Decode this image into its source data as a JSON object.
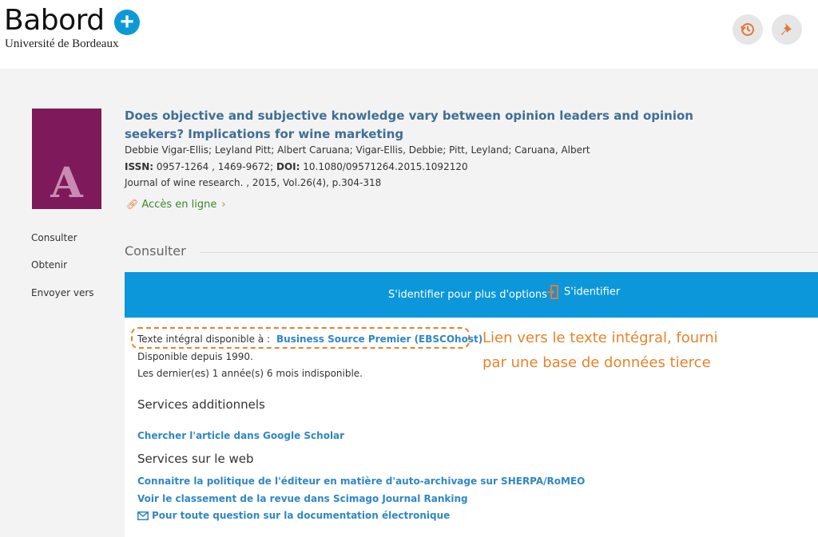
{
  "header": {
    "logo_title": "Babord",
    "logo_plus": "+",
    "logo_subtitle": "Université de Bordeaux",
    "icons": [
      "history-icon",
      "pin-icon"
    ]
  },
  "record": {
    "cover_letter": "A",
    "title": "Does objective and subjective knowledge vary between opinion leaders and opinion seekers? Implications for wine marketing",
    "authors": "Debbie Vigar-Ellis; Leyland Pitt; Albert Caruana; Vigar-Ellis, Debbie; Pitt, Leyland; Caruana, Albert",
    "issn_label": "ISSN:",
    "issn_value": " 0957-1264 , 1469-9672; ",
    "doi_label": "DOI:",
    "doi_value": " 10.1080/09571264.2015.1092120",
    "source": "Journal of wine research. , 2015, Vol.26(4), p.304-318",
    "access_link": "Accès en ligne"
  },
  "nav": {
    "items": [
      "Consulter",
      "Obtenir",
      "Envoyer vers"
    ]
  },
  "consulter": {
    "heading": "Consulter",
    "login_text": "S'identifier pour plus d'options",
    "login_button": "S'identifier",
    "fulltext_label": "Texte intégral disponible à :",
    "fulltext_link": "Business Source Premier (EBSCOhost)",
    "available_since": "Disponible depuis 1990.",
    "embargo": "Les dernier(es) 1 année(s) 6 mois indisponible.",
    "annotation_line1": "Lien vers le texte intégral, fourni",
    "annotation_line2": "par une base de données tierce",
    "additional_heading": "Services additionnels",
    "google_scholar_link": "Chercher l'article dans Google Scholar",
    "web_heading": "Services sur le web",
    "sherpa_link": "Connaitre la politique de l'éditeur en matière d'auto-archivage sur SHERPA/RoMEO",
    "scimago_link": "Voir le classement de la revue dans Scimago Journal Ranking",
    "question_link": "Pour toute question sur la documentation électronique"
  },
  "colors": {
    "accent_blue": "#0b97da",
    "link_blue": "#2f87c6",
    "annotation_orange": "#e8832a",
    "cover_purple": "#7e1a5b"
  }
}
